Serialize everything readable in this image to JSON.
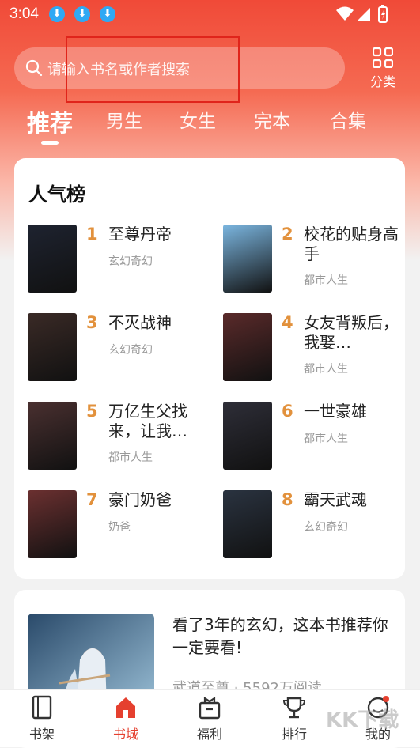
{
  "status_bar": {
    "time": "3:04"
  },
  "search": {
    "placeholder": "请输入书名或作者搜索"
  },
  "category_label": "分类",
  "tabs": [
    {
      "label": "推荐",
      "active": true
    },
    {
      "label": "男生"
    },
    {
      "label": "女生"
    },
    {
      "label": "完本"
    },
    {
      "label": "合集"
    }
  ],
  "ranking": {
    "title": "人气榜",
    "books": [
      {
        "rank": "1",
        "title": "至尊丹帝",
        "category": "玄幻奇幻",
        "cover_color": "#1e2330"
      },
      {
        "rank": "2",
        "title": "校花的贴身高手",
        "category": "都市人生",
        "cover_color": "#7bb6e0"
      },
      {
        "rank": "3",
        "title": "不灭战神",
        "category": "玄幻奇幻",
        "cover_color": "#3a2a26"
      },
      {
        "rank": "4",
        "title": "女友背叛后，我娶…",
        "category": "都市人生",
        "cover_color": "#5a2a2a"
      },
      {
        "rank": "5",
        "title": "万亿生父找来，让我…",
        "category": "都市人生",
        "cover_color": "#4a3030"
      },
      {
        "rank": "6",
        "title": "一世豪雄",
        "category": "都市人生",
        "cover_color": "#2e2e38"
      },
      {
        "rank": "7",
        "title": "豪门奶爸",
        "category": "奶爸",
        "cover_color": "#6b3030"
      },
      {
        "rank": "8",
        "title": "霸天武魂",
        "category": "玄幻奇幻",
        "cover_color": "#2a3340"
      }
    ]
  },
  "promo": {
    "title": "看了3年的玄幻，这本书推荐你一定要看!",
    "meta": "武道至尊 · 5592万阅读"
  },
  "bottom_nav": [
    {
      "label": "书架"
    },
    {
      "label": "书城",
      "active": true
    },
    {
      "label": "福利"
    },
    {
      "label": "排行"
    },
    {
      "label": "我的"
    }
  ],
  "watermark": "KK下载",
  "colors": {
    "accent": "#e5402f",
    "rank": "#e2913c"
  }
}
